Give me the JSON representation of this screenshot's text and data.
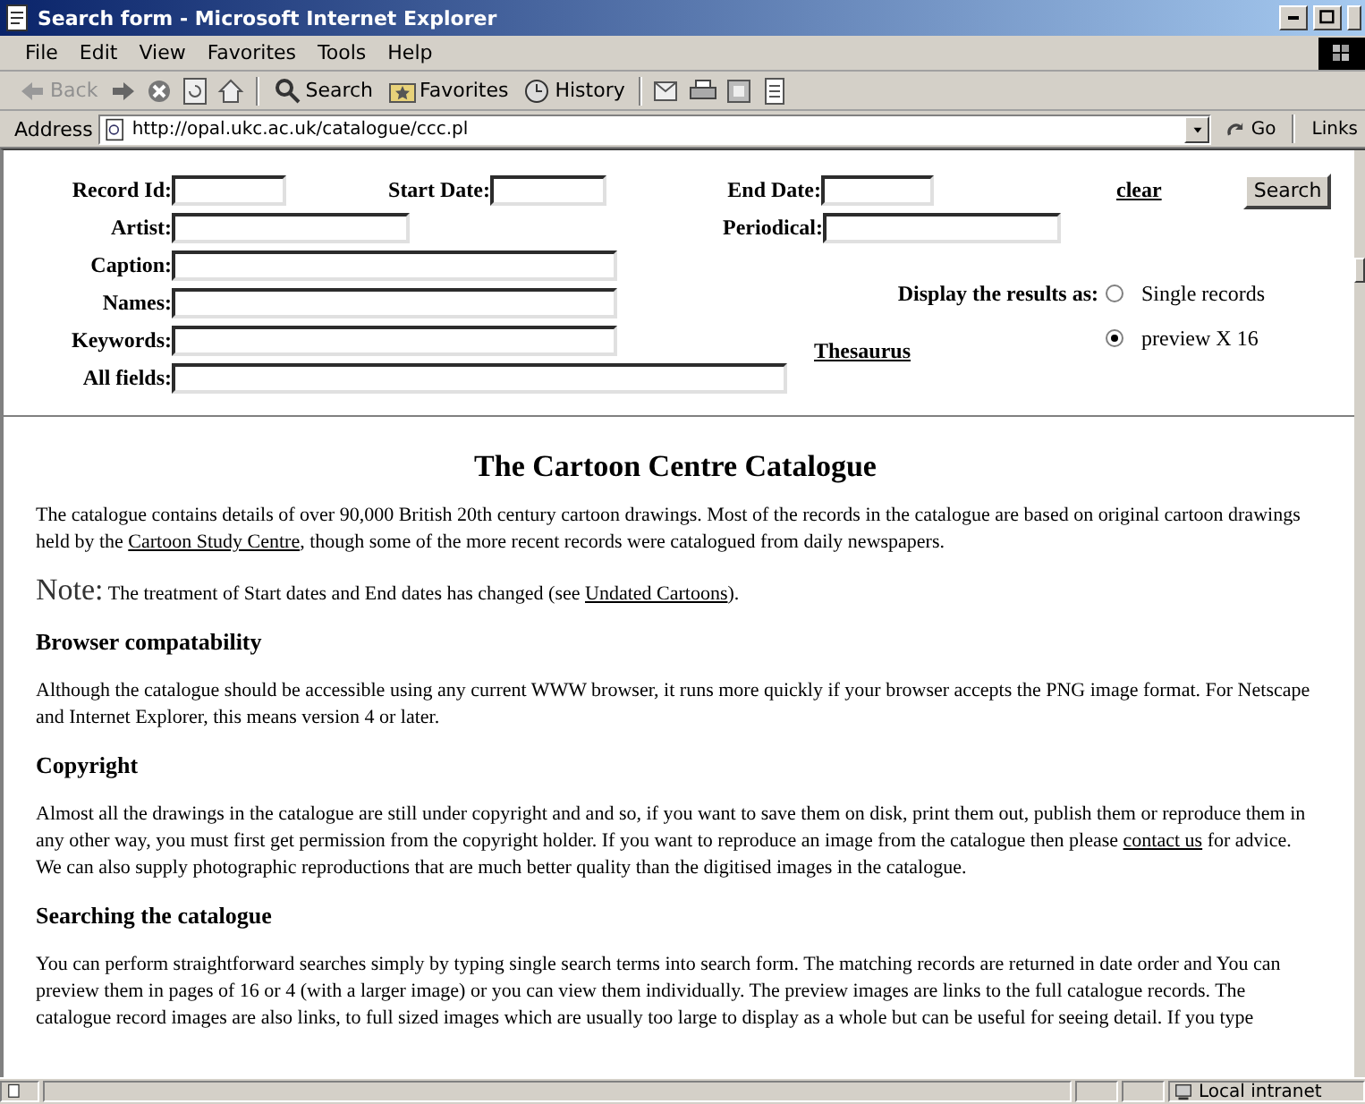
{
  "window": {
    "title": "Search form - Microsoft Internet Explorer"
  },
  "menu": [
    "File",
    "Edit",
    "View",
    "Favorites",
    "Tools",
    "Help"
  ],
  "toolbar": {
    "back": {
      "label": "Back",
      "disabled": true
    },
    "buttons": [
      {
        "label": "Search",
        "kind": "search"
      },
      {
        "label": "Favorites",
        "kind": "favorites"
      },
      {
        "label": "History",
        "kind": "history"
      }
    ]
  },
  "address_bar": {
    "label": "Address",
    "url": "http://opal.ukc.ac.uk/catalogue/ccc.pl",
    "go": "Go",
    "links": "Links"
  },
  "form": {
    "record_id": "Record Id:",
    "start_date": "Start Date:",
    "end_date": "End Date:",
    "clear": "clear",
    "search": "Search",
    "artist": "Artist:",
    "periodical": "Periodical:",
    "caption": "Caption:",
    "names": "Names:",
    "keywords": "Keywords:",
    "all_fields": "All fields:",
    "thesaurus": "Thesaurus",
    "display_label": "Display the results as:",
    "display_options": [
      {
        "label": "Single records",
        "selected": false
      },
      {
        "label": "preview X 16",
        "selected": true
      }
    ]
  },
  "page": {
    "title": "The Cartoon Centre Catalogue",
    "blocks": [
      {
        "kind": "para",
        "segments": [
          {
            "text": "The catalogue contains details of over 90,000 British 20th century cartoon drawings. Most of the records in the catalogue are based on original cartoon drawings held by the "
          },
          {
            "text": "Cartoon Study Centre",
            "kind": "link"
          },
          {
            "text": ", though some of the more recent records were catalogued from daily newspapers."
          }
        ]
      },
      {
        "kind": "note",
        "lead": "Note:",
        "segments": [
          {
            "text": "The treatment of Start dates and End dates has changed (see "
          },
          {
            "text": "Undated Cartoons",
            "kind": "link"
          },
          {
            "text": ")."
          }
        ]
      },
      {
        "kind": "heading",
        "text": "Browser compatability"
      },
      {
        "kind": "para",
        "segments": [
          {
            "text": "Although the catalogue should be accessible using any current WWW browser, it runs more quickly if your browser accepts the PNG image format. For Netscape and Internet Explorer, this means version 4 or later."
          }
        ]
      },
      {
        "kind": "heading",
        "text": "Copyright"
      },
      {
        "kind": "para",
        "segments": [
          {
            "text": "Almost all the drawings in the catalogue are still under copyright and and so, if you want to save them on disk, print them out, publish them or reproduce them in any other way, you must first get permission from the copyright holder. If you want to reproduce an image from the catalogue then please "
          },
          {
            "text": "contact us",
            "kind": "link"
          },
          {
            "text": " for advice. We can also supply photographic reproductions that are much better quality than the digitised images in the catalogue."
          }
        ]
      },
      {
        "kind": "heading",
        "text": "Searching the catalogue"
      },
      {
        "kind": "para",
        "segments": [
          {
            "text": "You can perform straightforward searches simply by typing single search terms into search form. The matching records are returned in date order and You can preview them in pages of 16 or 4 (with a larger image) or you can view them individually. The preview images are links to the full catalogue records. The catalogue record images are also links, to full sized images which are usually too large to display as a whole but can be useful for seeing detail. If you type"
          }
        ]
      }
    ]
  },
  "status_bar": {
    "zone": "Local intranet"
  }
}
